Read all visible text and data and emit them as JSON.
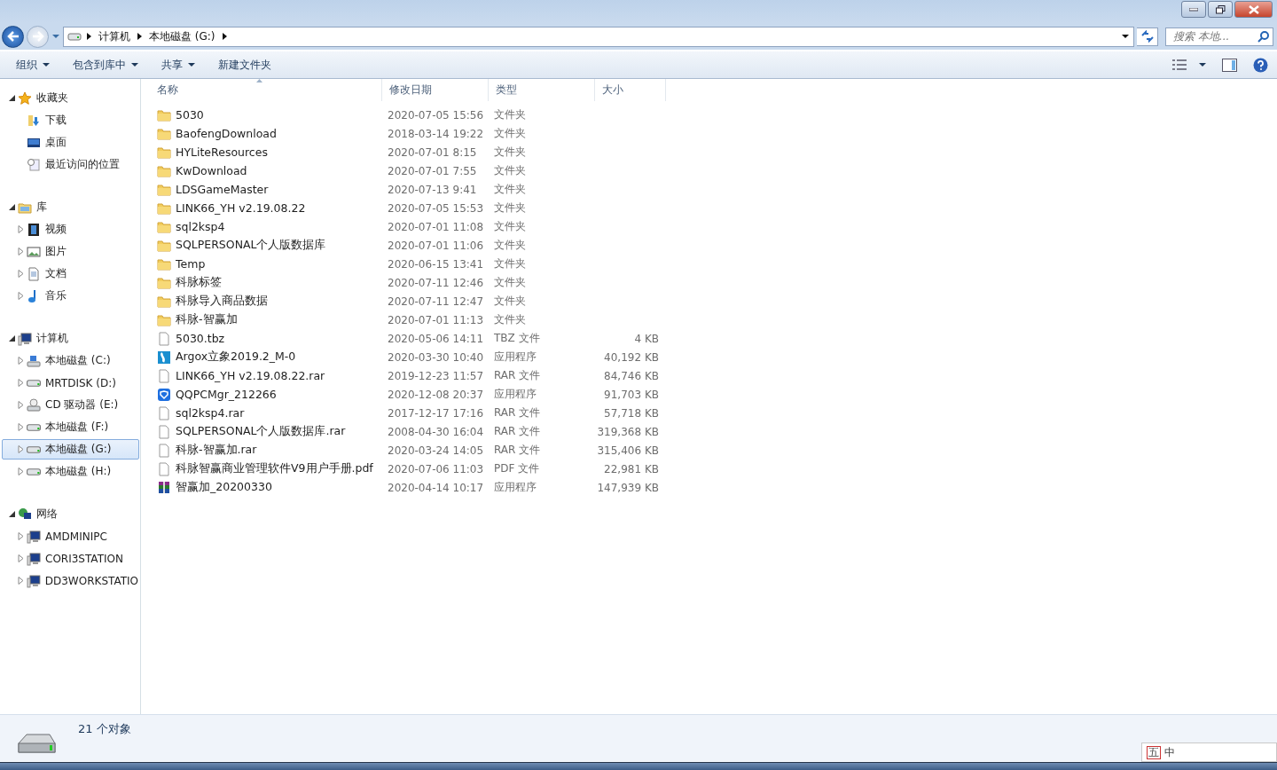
{
  "address": {
    "crumbs": [
      "计算机",
      "本地磁盘 (G:)"
    ]
  },
  "search": {
    "placeholder": "搜索 本地..."
  },
  "toolbar": {
    "buttons": [
      {
        "label": "组织",
        "dropdown": true
      },
      {
        "label": "包含到库中",
        "dropdown": true
      },
      {
        "label": "共享",
        "dropdown": true
      },
      {
        "label": "新建文件夹",
        "dropdown": false
      }
    ]
  },
  "sidebar": {
    "sections": [
      {
        "label": "收藏夹",
        "expanded": true,
        "children": [
          {
            "label": "下载",
            "expandable": false,
            "selected": false
          },
          {
            "label": "桌面",
            "expandable": false,
            "selected": false
          },
          {
            "label": "最近访问的位置",
            "expandable": false,
            "selected": false
          }
        ]
      },
      {
        "label": "库",
        "expanded": true,
        "children": [
          {
            "label": "视频",
            "expandable": true,
            "selected": false
          },
          {
            "label": "图片",
            "expandable": true,
            "selected": false
          },
          {
            "label": "文档",
            "expandable": true,
            "selected": false
          },
          {
            "label": "音乐",
            "expandable": true,
            "selected": false
          }
        ]
      },
      {
        "label": "计算机",
        "expanded": true,
        "children": [
          {
            "label": "本地磁盘 (C:)",
            "expandable": true,
            "selected": false
          },
          {
            "label": "MRTDISK (D:)",
            "expandable": true,
            "selected": false
          },
          {
            "label": "CD 驱动器 (E:)",
            "expandable": true,
            "selected": false
          },
          {
            "label": "本地磁盘 (F:)",
            "expandable": true,
            "selected": false
          },
          {
            "label": "本地磁盘 (G:)",
            "expandable": true,
            "selected": true
          },
          {
            "label": "本地磁盘 (H:)",
            "expandable": true,
            "selected": false
          }
        ]
      },
      {
        "label": "网络",
        "expanded": true,
        "children": [
          {
            "label": "AMDMINIPC",
            "expandable": true,
            "selected": false
          },
          {
            "label": "CORI3STATION",
            "expandable": true,
            "selected": false
          },
          {
            "label": "DD3WORKSTATIO",
            "expandable": true,
            "selected": false
          }
        ]
      }
    ]
  },
  "table": {
    "columns": [
      {
        "label": "名称",
        "sorted": true
      },
      {
        "label": "修改日期",
        "sorted": false
      },
      {
        "label": "类型",
        "sorted": false
      },
      {
        "label": "大小",
        "sorted": false
      }
    ],
    "rows": [
      {
        "kind": "folder",
        "name": "5030",
        "date": "2020-07-05 15:56",
        "type": "文件夹"
      },
      {
        "kind": "folder",
        "name": "BaofengDownload",
        "date": "2018-03-14 19:22",
        "type": "文件夹"
      },
      {
        "kind": "folder",
        "name": "HYLiteResources",
        "date": "2020-07-01 8:15",
        "type": "文件夹"
      },
      {
        "kind": "folder",
        "name": "KwDownload",
        "date": "2020-07-01 7:55",
        "type": "文件夹"
      },
      {
        "kind": "folder",
        "name": "LDSGameMaster",
        "date": "2020-07-13 9:41",
        "type": "文件夹"
      },
      {
        "kind": "folder",
        "name": "LINK66_YH v2.19.08.22",
        "date": "2020-07-05 15:53",
        "type": "文件夹"
      },
      {
        "kind": "folder",
        "name": "sql2ksp4",
        "date": "2020-07-01 11:08",
        "type": "文件夹"
      },
      {
        "kind": "folder",
        "name": "SQLPERSONAL个人版数据库",
        "date": "2020-07-01 11:06",
        "type": "文件夹"
      },
      {
        "kind": "folder",
        "name": "Temp",
        "date": "2020-06-15 13:41",
        "type": "文件夹"
      },
      {
        "kind": "folder",
        "name": "科脉标签",
        "date": "2020-07-11 12:46",
        "type": "文件夹"
      },
      {
        "kind": "folder",
        "name": "科脉导入商品数据",
        "date": "2020-07-11 12:47",
        "type": "文件夹"
      },
      {
        "kind": "folder",
        "name": "科脉-智赢加",
        "date": "2020-07-01 11:13",
        "type": "文件夹"
      },
      {
        "kind": "file",
        "name": "5030.tbz",
        "date": "2020-05-06 14:11",
        "type": "TBZ 文件",
        "size": "4 KB"
      },
      {
        "kind": "app-logo",
        "name": "Argox立象2019.2_M-0",
        "date": "2020-03-30 10:40",
        "type": "应用程序",
        "size": "40,192 KB"
      },
      {
        "kind": "file",
        "name": "LINK66_YH v2.19.08.22.rar",
        "date": "2019-12-23 11:57",
        "type": "RAR 文件",
        "size": "84,746 KB"
      },
      {
        "kind": "app-shield",
        "name": "QQPCMgr_212266",
        "date": "2020-12-08 20:37",
        "type": "应用程序",
        "size": "91,703 KB"
      },
      {
        "kind": "file",
        "name": "sql2ksp4.rar",
        "date": "2017-12-17 17:16",
        "type": "RAR 文件",
        "size": "57,718 KB"
      },
      {
        "kind": "file",
        "name": "SQLPERSONAL个人版数据库.rar",
        "date": "2008-04-30 16:04",
        "type": "RAR 文件",
        "size": "319,368 KB"
      },
      {
        "kind": "file",
        "name": "科脉-智赢加.rar",
        "date": "2020-03-24 14:05",
        "type": "RAR 文件",
        "size": "315,406 KB"
      },
      {
        "kind": "file",
        "name": "科脉智赢商业管理软件V9用户手册.pdf",
        "date": "2020-07-06 11:03",
        "type": "PDF 文件",
        "size": "22,981 KB"
      },
      {
        "kind": "app-archive",
        "name": "智赢加_20200330",
        "date": "2020-04-14 10:17",
        "type": "应用程序",
        "size": "147,939 KB"
      }
    ]
  },
  "status_bar": {
    "text": "21 个对象"
  },
  "ime": {
    "labels": [
      "五",
      "中"
    ]
  }
}
